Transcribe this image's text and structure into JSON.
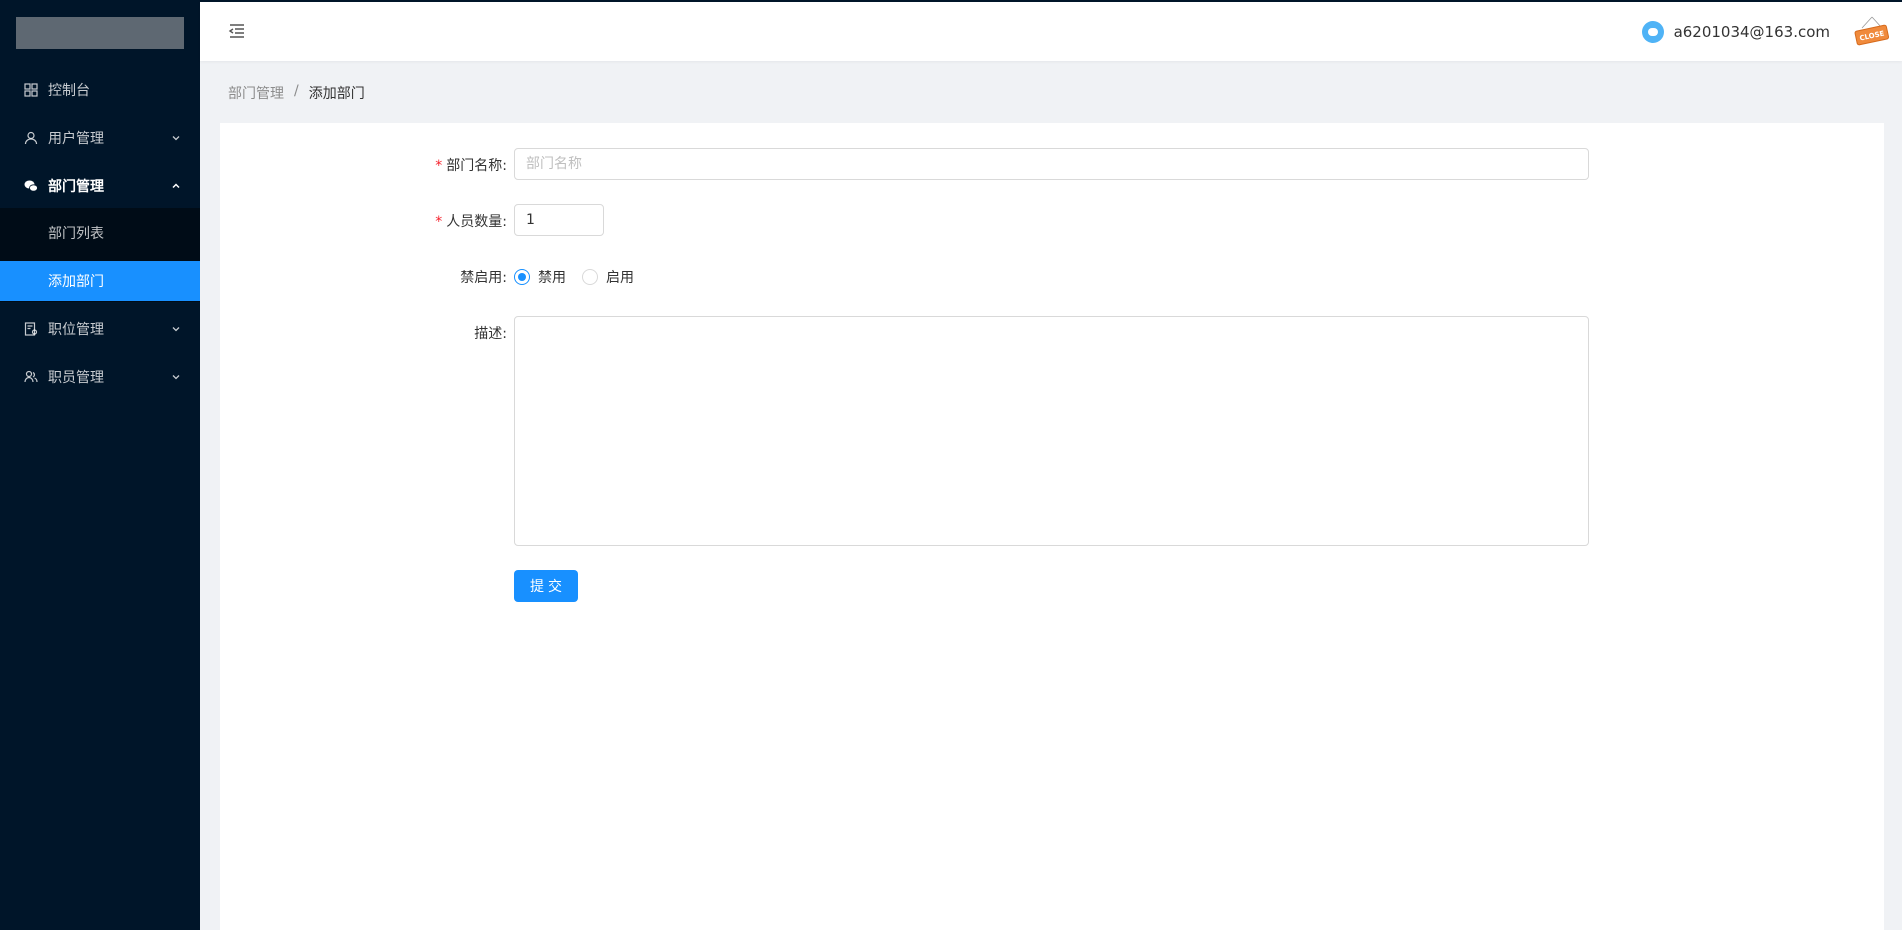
{
  "sidebar": {
    "menu": [
      {
        "label": "控制台",
        "icon": "dashboard-icon"
      },
      {
        "label": "用户管理",
        "icon": "user-icon"
      },
      {
        "label": "部门管理",
        "icon": "wechat-icon"
      },
      {
        "label": "职位管理",
        "icon": "solution-icon"
      },
      {
        "label": "职员管理",
        "icon": "team-icon"
      }
    ],
    "submenu": [
      {
        "label": "部门列表"
      },
      {
        "label": "添加部门"
      }
    ]
  },
  "header": {
    "user_email": "a6201034@163.com",
    "close_label": "CLOSE"
  },
  "breadcrumb": {
    "parent": "部门管理",
    "separator": "/",
    "current": "添加部门"
  },
  "form": {
    "name_label": "部门名称:",
    "name_placeholder": "部门名称",
    "count_label": "人员数量:",
    "count_value": "1",
    "status_label": "禁启用:",
    "status_options": [
      "禁用",
      "启用"
    ],
    "status_selected": "禁用",
    "desc_label": "描述:",
    "required_mark": "*",
    "submit_label": "提交"
  },
  "colors": {
    "sidebar_bg": "#001529",
    "accent": "#1890ff",
    "required": "#f5222d"
  }
}
